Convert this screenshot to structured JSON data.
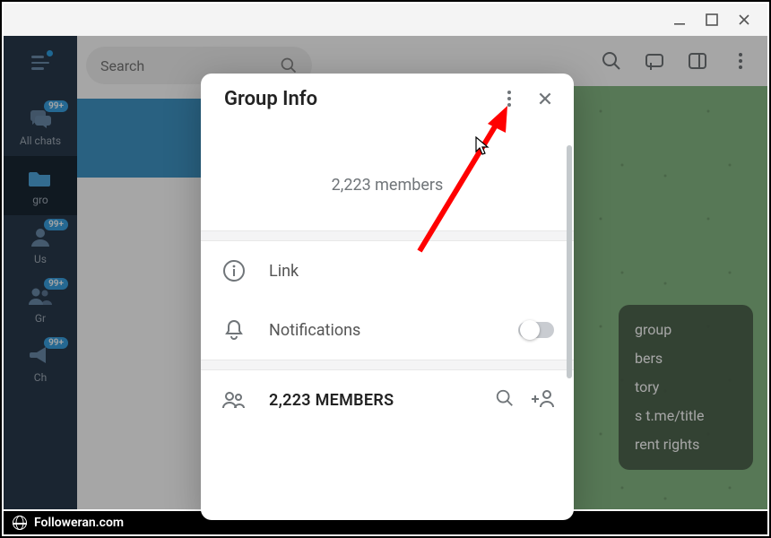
{
  "window": {
    "controls": [
      "minimize",
      "maximize",
      "close"
    ]
  },
  "sidebar": {
    "badge": "99+",
    "items": [
      {
        "label": "All chats",
        "icon": "chat-bubbles-icon",
        "badge": true
      },
      {
        "label": "gro",
        "icon": "folder-icon",
        "active": true
      },
      {
        "label": "Us",
        "icon": "person-icon",
        "badge": true
      },
      {
        "label": "Gr",
        "icon": "people-icon",
        "badge": true
      },
      {
        "label": "Ch",
        "icon": "megaphone-icon",
        "badge": true
      }
    ]
  },
  "search": {
    "placeholder": "Search"
  },
  "topbar": {
    "icons": [
      "search-icon",
      "comments-icon",
      "sidepanel-icon",
      "more-icon"
    ]
  },
  "context_menu": {
    "items": [
      "group",
      "bers",
      "tory",
      "s t.me/title",
      "rent rights"
    ]
  },
  "modal": {
    "title": "Group Info",
    "members_text": "2,223 members",
    "rows": {
      "link": {
        "label": "Link"
      },
      "notifications": {
        "label": "Notifications",
        "toggle_on": false
      },
      "members": {
        "label": "2,223 MEMBERS"
      }
    }
  },
  "watermark": {
    "text": "Followeran.com"
  }
}
